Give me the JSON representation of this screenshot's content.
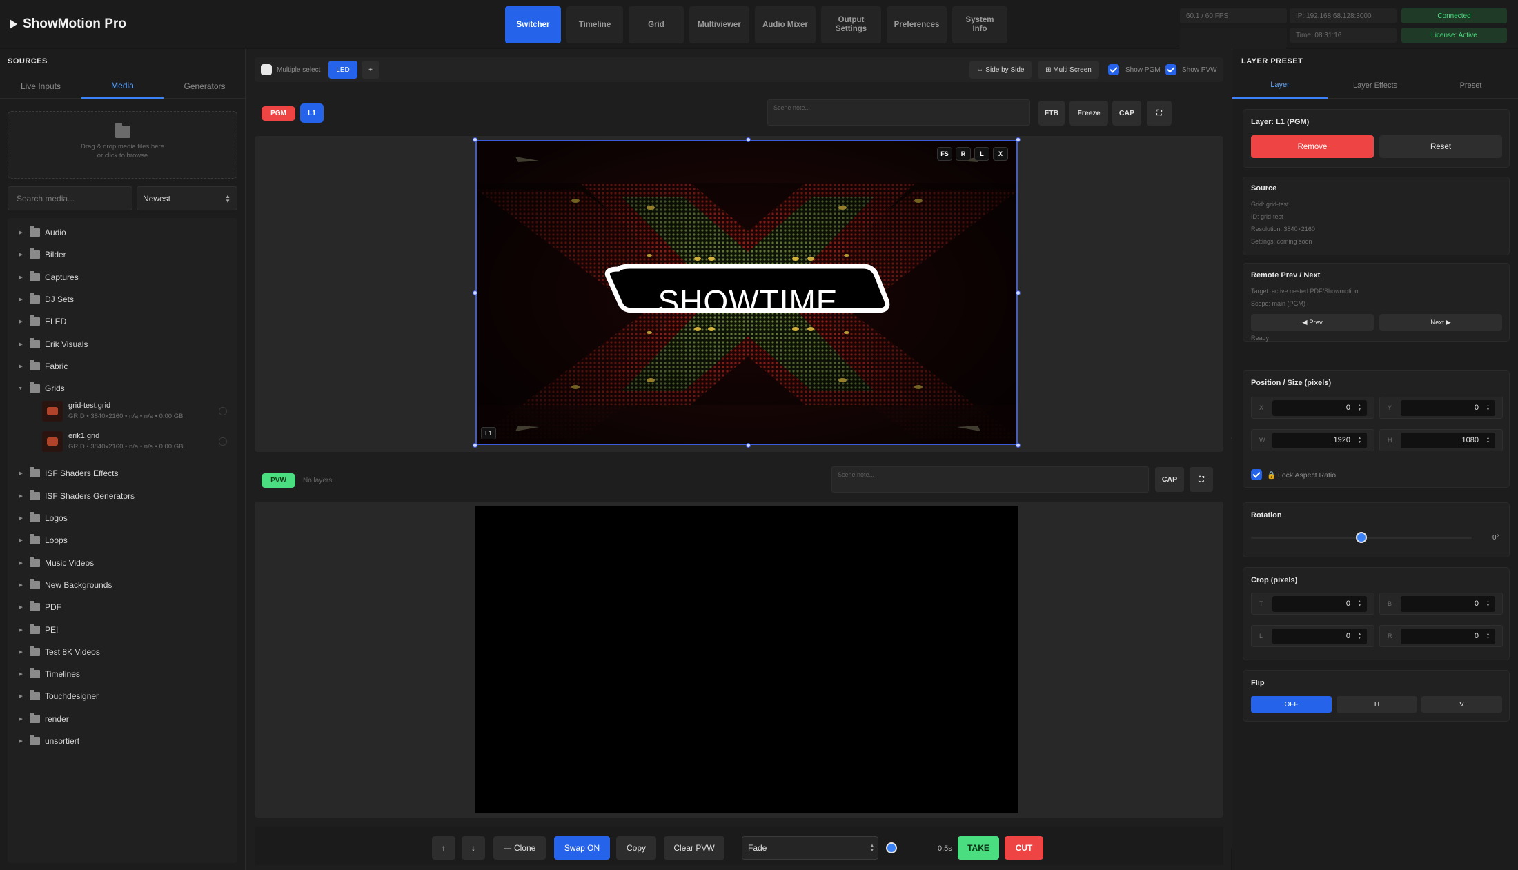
{
  "app": {
    "title": "ShowMotion Pro"
  },
  "nav": [
    {
      "label": "Switcher",
      "active": true
    },
    {
      "label": "Timeline"
    },
    {
      "label": "Grid"
    },
    {
      "label": "Multiviewer"
    },
    {
      "label": "Audio Mixer"
    },
    {
      "label": "Output\nSettings"
    },
    {
      "label": "Preferences"
    },
    {
      "label": "System Info"
    }
  ],
  "status": {
    "fps": "60.1 / 60 FPS",
    "ip": "IP: 192.168.68.128:3000",
    "connected": "Connected",
    "dash": "--",
    "time": "Time: 08:31:16",
    "license": "License: Active"
  },
  "sources": {
    "title": "SOURCES",
    "tabs": [
      "Live Inputs",
      "Media",
      "Generators"
    ],
    "active_tab": "Media",
    "drop_line1": "Drag & drop media files here",
    "drop_line2": "or click to browse",
    "search_placeholder": "Search media...",
    "sort": "Newest",
    "folders_before": [
      "Audio",
      "Bilder",
      "Captures",
      "DJ Sets",
      "ELED",
      "Erik Visuals",
      "Fabric"
    ],
    "open_folder": "Grids",
    "files": [
      {
        "name": "grid-test.grid",
        "meta": "GRID • 3840x2160 • n/a • n/a • 0.00 GB"
      },
      {
        "name": "erik1.grid",
        "meta": "GRID • 3840x2160 • n/a • n/a • 0.00 GB"
      }
    ],
    "folders_after": [
      "ISF Shaders Effects",
      "ISF Shaders Generators",
      "Logos",
      "Loops",
      "Music Videos",
      "New Backgrounds",
      "PDF",
      "PEI",
      "Test 8K Videos",
      "Timelines",
      "Touchdesigner",
      "render",
      "unsortiert"
    ]
  },
  "toolbar": {
    "multiple_select": "Multiple select",
    "led": "LED",
    "plus": "+",
    "side_by_side": "⇔ Side by Side",
    "multi_screen": "⊞ Multi Screen",
    "show_pgm": "Show PGM",
    "show_pvw": "Show PVW"
  },
  "pgm": {
    "badge": "PGM",
    "layer_badge": "L1",
    "note_placeholder": "Scene note...",
    "ftb": "FTB",
    "freeze": "Freeze",
    "cap": "CAP",
    "expand": "⛶",
    "overlay": [
      "FS",
      "R",
      "L",
      "X"
    ],
    "layer_tag": "L1",
    "content_text": "SHOWTIME"
  },
  "pvw": {
    "badge": "PVW",
    "no_layers": "No layers",
    "note_placeholder": "Scene note...",
    "cap": "CAP",
    "expand": "⛶"
  },
  "bottom": {
    "up": "↑",
    "down": "↓",
    "clone": "--- Clone",
    "swap": "Swap ON",
    "copy": "Copy",
    "clear": "Clear PVW",
    "transition": "Fade",
    "duration": "0.5s",
    "take": "TAKE",
    "cut": "CUT"
  },
  "layer_preset": {
    "title": "LAYER PRESET",
    "tabs": [
      "Layer",
      "Layer Effects",
      "Preset"
    ],
    "active_tab": "Layer",
    "layer_title": "Layer: L1 (PGM)",
    "remove": "Remove",
    "reset": "Reset",
    "source_title": "Source",
    "source_lines": [
      "Grid: grid-test",
      "ID: grid-test",
      "Resolution: 3840×2160",
      "Settings: coming soon"
    ],
    "remote_title": "Remote Prev / Next",
    "remote_lines": [
      "Target: active nested PDF/Showmotion",
      "Scope: main (PGM)"
    ],
    "prev": "◀ Prev",
    "next": "Next ▶",
    "ready": "Ready",
    "pos_title": "Position / Size (pixels)",
    "pos": [
      {
        "label": "X",
        "value": "0"
      },
      {
        "label": "Y",
        "value": "0"
      },
      {
        "label": "W",
        "value": "1920"
      },
      {
        "label": "H",
        "value": "1080"
      }
    ],
    "lock_aspect": "🔒 Lock Aspect Ratio",
    "rotation_title": "Rotation",
    "rotation_value": "0°",
    "crop_title": "Crop (pixels)",
    "crop": [
      {
        "label": "T",
        "value": "0"
      },
      {
        "label": "B",
        "value": "0"
      },
      {
        "label": "L",
        "value": "0"
      },
      {
        "label": "R",
        "value": "0"
      }
    ],
    "flip_title": "Flip",
    "flip": [
      "OFF",
      "H",
      "V"
    ],
    "flip_active": "OFF"
  }
}
